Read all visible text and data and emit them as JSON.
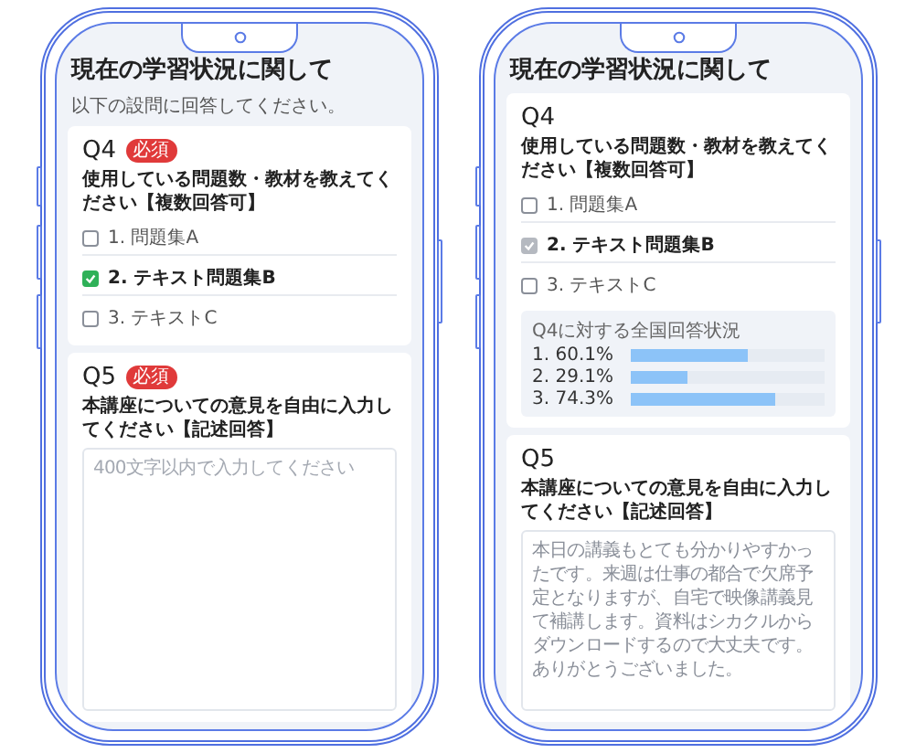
{
  "phones": [
    {
      "title": "現在の学習状況に関して",
      "subtitle": "以下の設問に回答してください。",
      "questions": [
        {
          "kind": "choice",
          "number": "Q4",
          "badge": "必須",
          "text": "使用している問題数・教材を教えてください【複数回答可】",
          "disabled": false,
          "options": [
            {
              "label": "1. 問題集A",
              "checked": false
            },
            {
              "label": "2. テキスト問題集B",
              "checked": true
            },
            {
              "label": "3. テキストC",
              "checked": false
            }
          ]
        },
        {
          "kind": "text",
          "number": "Q5",
          "badge": "必須",
          "text": "本講座についての意見を自由に入力してください【記述回答】",
          "placeholder": "400文字以内で入力してください"
        }
      ]
    },
    {
      "title": "現在の学習状況に関して",
      "questions": [
        {
          "kind": "choice",
          "number": "Q4",
          "text": "使用している問題数・教材を教えてください【複数回答可】",
          "disabled": true,
          "options": [
            {
              "label": "1. 問題集A",
              "checked": false
            },
            {
              "label": "2. テキスト問題集B",
              "checked": true
            },
            {
              "label": "3. テキストC",
              "checked": false
            }
          ],
          "results": {
            "title": "Q4に対する全国回答状況",
            "rows": [
              {
                "label": "1. 60.1%",
                "level": 0.601
              },
              {
                "label": "2. 29.1%",
                "level": 0.291
              },
              {
                "label": "3. 74.3%",
                "level": 0.743
              }
            ]
          }
        },
        {
          "kind": "text",
          "number": "Q5",
          "text": "本講座についての意見を自由に入力してください【記述回答】",
          "value": "本日の講義もとても分かりやすかったです。来週は仕事の都合で欠席予定となりますが、自宅で映像講義見て補講します。資料はシカクルからダウンロードするので大丈夫です。ありがとうございました。"
        }
      ]
    }
  ]
}
